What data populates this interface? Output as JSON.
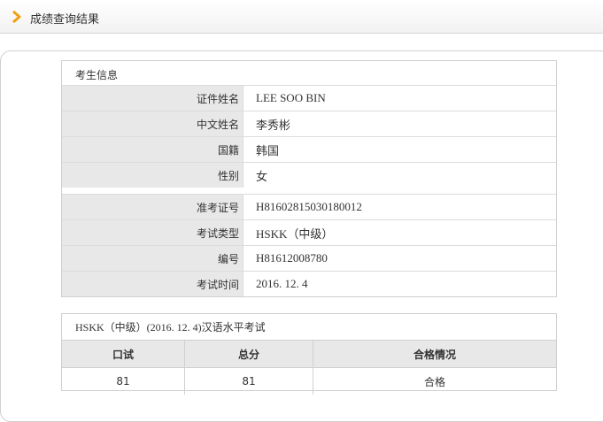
{
  "header": {
    "title": "成绩查询结果"
  },
  "candidate": {
    "section_title": "考生信息",
    "rows_a": [
      {
        "label": "证件姓名",
        "value": "LEE SOO BIN"
      },
      {
        "label": "中文姓名",
        "value": "李秀彬"
      },
      {
        "label": "国籍",
        "value": "韩国"
      },
      {
        "label": "性别",
        "value": "女"
      }
    ],
    "rows_b": [
      {
        "label": "准考证号",
        "value": "H81602815030180012"
      },
      {
        "label": "考试类型",
        "value": "HSKK（中级）"
      },
      {
        "label": "编号",
        "value": "H81612008780"
      },
      {
        "label": "考试时间",
        "value": "2016. 12. 4"
      }
    ]
  },
  "score": {
    "section_title": "HSKK（中级）(2016. 12. 4)汉语水平考试",
    "headers": [
      "口试",
      "总分",
      "合格情况"
    ],
    "row": [
      "81",
      "81",
      "合格"
    ]
  },
  "colors": {
    "accent": "#f0a010",
    "label_bg": "#e8e8e8",
    "border": "#d0d0d0"
  }
}
